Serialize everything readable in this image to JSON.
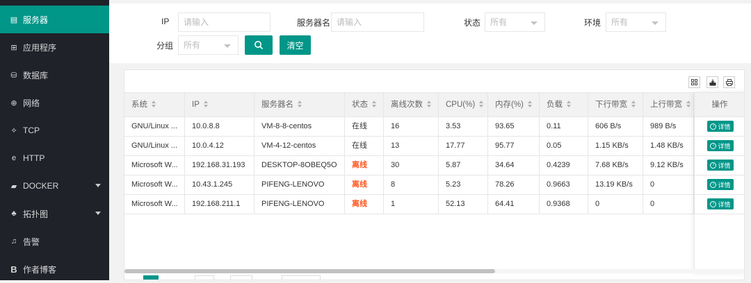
{
  "sidebar": {
    "items": [
      {
        "label": "服务器",
        "icon": "server-icon",
        "glyph": "▤",
        "active": true
      },
      {
        "label": "应用程序",
        "icon": "app-icon",
        "glyph": "⊞",
        "active": false
      },
      {
        "label": "数据库",
        "icon": "database-icon",
        "glyph": "⛁",
        "active": false
      },
      {
        "label": "网络",
        "icon": "network-icon",
        "glyph": "⊕",
        "active": false
      },
      {
        "label": "TCP",
        "icon": "tcp-icon",
        "glyph": "⟡",
        "active": false
      },
      {
        "label": "HTTP",
        "icon": "http-icon",
        "glyph": "e",
        "active": false
      },
      {
        "label": "DOCKER",
        "icon": "docker-icon",
        "glyph": "▰",
        "active": false,
        "expandable": true
      },
      {
        "label": "拓扑图",
        "icon": "topology-icon",
        "glyph": "♣",
        "active": false,
        "expandable": true
      },
      {
        "label": "告警",
        "icon": "alarm-icon",
        "glyph": "♫",
        "active": false
      },
      {
        "label": "作者博客",
        "icon": "blog-icon",
        "glyph": "B",
        "active": false
      }
    ]
  },
  "filters": {
    "ip_label": "IP",
    "ip_placeholder": "请输入",
    "name_label": "服务器名",
    "name_placeholder": "请输入",
    "status_label": "状态",
    "status_value": "所有",
    "env_label": "环境",
    "env_value": "所有",
    "group_label": "分组",
    "group_value": "所有",
    "clear_label": "清空"
  },
  "table": {
    "columns": [
      "系统",
      "IP",
      "服务器名",
      "状态",
      "离线次数",
      "CPU(%)",
      "内存(%)",
      "负载",
      "下行带宽",
      "上行带宽"
    ],
    "action_header": "操作",
    "detail_label": "详情",
    "rows": [
      {
        "os": "GNU/Linux ...",
        "ip": "10.0.8.8",
        "name": "VM-8-8-centos",
        "status": "在线",
        "offline_count": "16",
        "cpu": "3.53",
        "mem": "93.65",
        "load": "0.11",
        "down": "606 B/s",
        "up": "989 B/s",
        "offline": false
      },
      {
        "os": "GNU/Linux ...",
        "ip": "10.0.4.12",
        "name": "VM-4-12-centos",
        "status": "在线",
        "offline_count": "13",
        "cpu": "17.77",
        "mem": "95.77",
        "load": "0.05",
        "down": "1.15 KB/s",
        "up": "1.48 KB/s",
        "offline": false
      },
      {
        "os": "Microsoft W...",
        "ip": "192.168.31.193",
        "name": "DESKTOP-8OBEQ5O",
        "status": "离线",
        "offline_count": "30",
        "cpu": "5.87",
        "mem": "34.64",
        "load": "0.4239",
        "down": "7.68 KB/s",
        "up": "9.12 KB/s",
        "offline": true
      },
      {
        "os": "Microsoft W...",
        "ip": "10.43.1.245",
        "name": "PIFENG-LENOVO",
        "status": "离线",
        "offline_count": "8",
        "cpu": "5.23",
        "mem": "78.26",
        "load": "0.9663",
        "down": "13.19 KB/s",
        "up": "0",
        "offline": true
      },
      {
        "os": "Microsoft W...",
        "ip": "192.168.211.1",
        "name": "PIFENG-LENOVO",
        "status": "离线",
        "offline_count": "1",
        "cpu": "52.13",
        "mem": "64.41",
        "load": "0.9368",
        "down": "0",
        "up": "0",
        "offline": true
      }
    ]
  },
  "colors": {
    "accent": "#009688",
    "sidebar_bg": "#20222a",
    "offline": "#ff5722"
  }
}
